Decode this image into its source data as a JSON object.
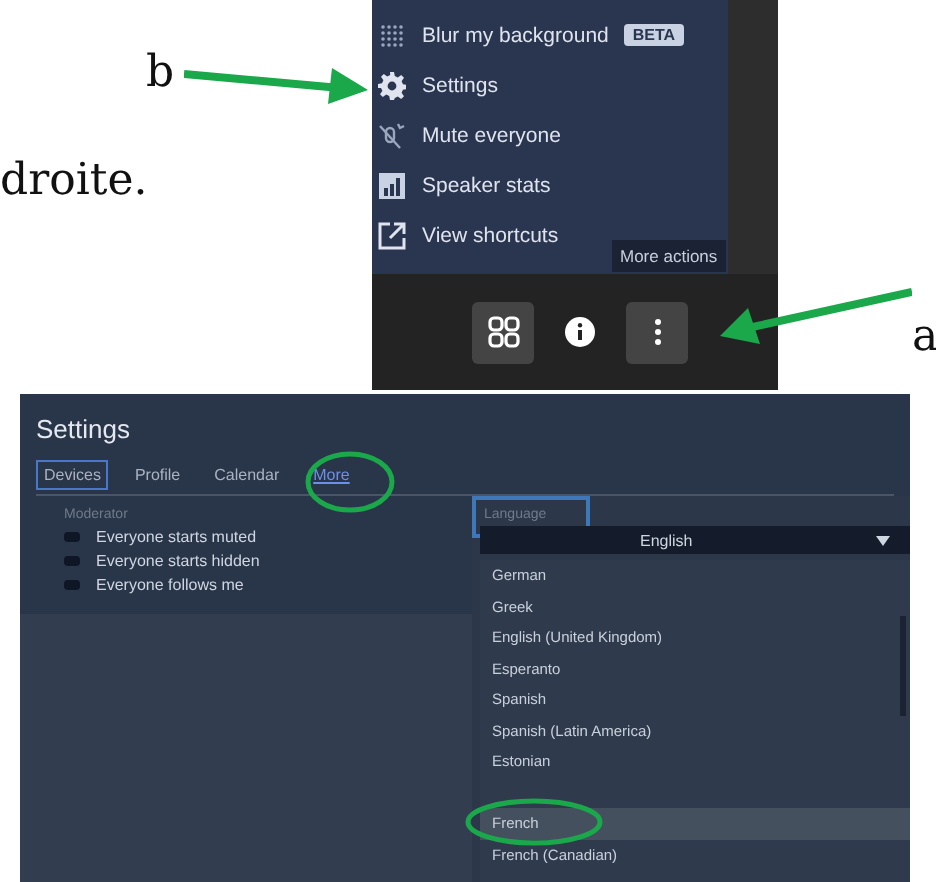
{
  "body_text": "droite.",
  "annotations": [
    {
      "label": "b"
    },
    {
      "label": "a"
    }
  ],
  "meeting_menu": {
    "items": [
      {
        "label": "Blur my background",
        "badge": "BETA"
      },
      {
        "label": "Settings"
      },
      {
        "label": "Mute everyone"
      },
      {
        "label": "Speaker stats"
      },
      {
        "label": "View shortcuts"
      }
    ],
    "tooltip": "More actions"
  },
  "settings": {
    "title": "Settings",
    "tabs": [
      {
        "label": "Devices",
        "selected": false,
        "focused": true
      },
      {
        "label": "Profile",
        "selected": false,
        "focused": false
      },
      {
        "label": "Calendar",
        "selected": false,
        "focused": false
      },
      {
        "label": "More",
        "selected": true,
        "focused": false
      }
    ],
    "moderator_heading": "Moderator",
    "options": [
      {
        "label": "Everyone starts muted",
        "checked": false
      },
      {
        "label": "Everyone starts hidden",
        "checked": false
      },
      {
        "label": "Everyone follows me",
        "checked": false
      }
    ],
    "language_label": "Language",
    "language_value": "English",
    "languages": [
      {
        "label": "German",
        "selected": false
      },
      {
        "label": "Greek",
        "selected": false
      },
      {
        "label": "English (United Kingdom)",
        "selected": false
      },
      {
        "label": "Esperanto",
        "selected": false
      },
      {
        "label": "Spanish",
        "selected": false
      },
      {
        "label": "Spanish (Latin America)",
        "selected": false
      },
      {
        "label": "Estonian",
        "selected": false
      },
      {
        "selected": false
      },
      {
        "label": "French",
        "selected": true
      },
      {
        "label": "French (Canadian)",
        "selected": false
      }
    ]
  }
}
